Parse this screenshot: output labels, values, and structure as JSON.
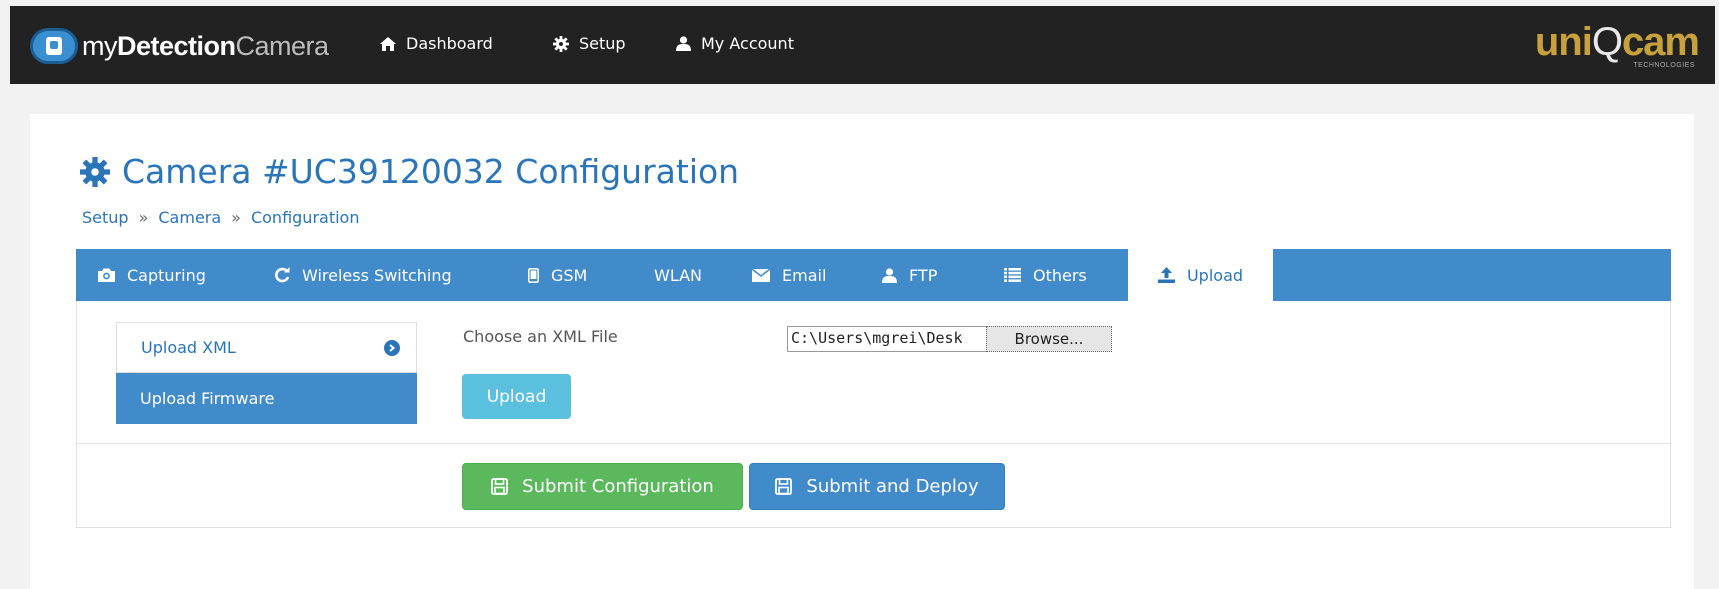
{
  "app": {
    "logo": {
      "prefix": "my",
      "bold": "Detection",
      "suffix": "Camera"
    },
    "brand": {
      "name_left": "uni",
      "name_mid": "Q",
      "name_right": "cam",
      "tagline": "TECHNOLOGIES"
    },
    "nav": [
      {
        "label": "Dashboard",
        "icon": "home-icon"
      },
      {
        "label": "Setup",
        "icon": "gear-icon"
      },
      {
        "label": "My Account",
        "icon": "user-icon"
      }
    ]
  },
  "page": {
    "title": "Camera #UC39120032 Configuration",
    "breadcrumb": [
      "Setup",
      "Camera",
      "Configuration"
    ],
    "breadcrumb_sep": "»"
  },
  "tabs": [
    {
      "label": "Capturing",
      "icon": "camera-icon"
    },
    {
      "label": "Wireless Switching",
      "icon": "refresh-icon"
    },
    {
      "label": "GSM",
      "icon": "phone-icon"
    },
    {
      "label": "WLAN",
      "icon": ""
    },
    {
      "label": "Email",
      "icon": "envelope-icon"
    },
    {
      "label": "FTP",
      "icon": "user-icon"
    },
    {
      "label": "Others",
      "icon": "list-icon"
    },
    {
      "label": "Upload",
      "icon": "upload-icon",
      "active": true
    }
  ],
  "side_menu": [
    {
      "label": "Upload XML",
      "icon": "chevron-right-circle-icon"
    },
    {
      "label": "Upload Firmware",
      "active": true
    }
  ],
  "upload_form": {
    "label": "Choose an XML File",
    "file_value": "C:\\Users\\mgrei\\Desk",
    "browse_label": "Browse...",
    "upload_button": "Upload"
  },
  "actions": {
    "submit_config": "Submit Configuration",
    "submit_deploy": "Submit and Deploy"
  },
  "colors": {
    "navbar": "#222222",
    "primary": "#428bca",
    "info": "#5bc0de",
    "success": "#5cb85c",
    "brand_gold": "#c9a13c"
  }
}
